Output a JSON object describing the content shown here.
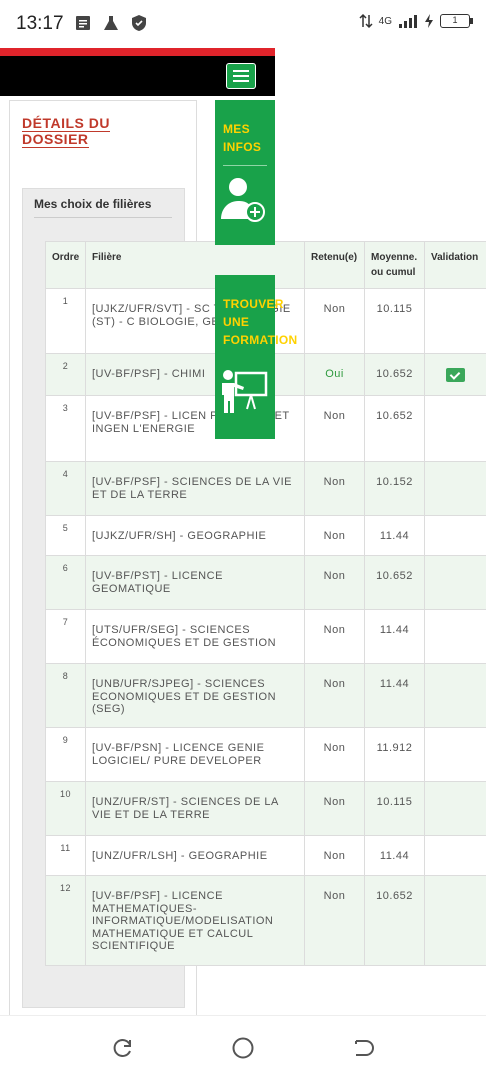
{
  "status_bar": {
    "time": "13:17",
    "network": "4G",
    "battery": "1"
  },
  "header": {
    "menu_icon": "hamburger-icon"
  },
  "panel": {
    "title": "DÉTAILS DU DOSSIER",
    "choices_title": "Mes choix de filières"
  },
  "cards": {
    "my_info_label": "MES\nINFOS",
    "my_info_icon": "user-add-icon",
    "find_training_label": "TROUVER\nUNE\nFORMATION",
    "find_training_icon": "teacher-board-icon"
  },
  "table": {
    "headers": [
      "Ordre",
      "Filière",
      "Retenu(e)",
      "Moyenne. ou cumul",
      "Validation"
    ],
    "rows": [
      {
        "ordre": "1",
        "filiere": "[UJKZ/UFR/SVT] - SC TEHNOLOGIE (ST) - C BIOLOGIE, GEOLOGI",
        "retenu": "Non",
        "moyenne": "10.115",
        "validated": false
      },
      {
        "ordre": "2",
        "filiere": "[UV-BF/PSF] - CHIMI",
        "retenu": "Oui",
        "moyenne": "10.652",
        "validated": true
      },
      {
        "ordre": "3",
        "filiere": "[UV-BF/PSF] - LICEN PHYSIQUE ET INGEN L'ENERGIE",
        "retenu": "Non",
        "moyenne": "10.652",
        "validated": false
      },
      {
        "ordre": "4",
        "filiere": "[UV-BF/PSF] - SCIENCES DE LA VIE ET DE LA TERRE",
        "retenu": "Non",
        "moyenne": "10.152",
        "validated": false
      },
      {
        "ordre": "5",
        "filiere": "[UJKZ/UFR/SH] - GEOGRAPHIE",
        "retenu": "Non",
        "moyenne": "11.44",
        "validated": false
      },
      {
        "ordre": "6",
        "filiere": "[UV-BF/PST] - LICENCE GEOMATIQUE",
        "retenu": "Non",
        "moyenne": "10.652",
        "validated": false
      },
      {
        "ordre": "7",
        "filiere": "[UTS/UFR/SEG] - SCIENCES ÉCONOMIQUES ET DE GESTION",
        "retenu": "Non",
        "moyenne": "11.44",
        "validated": false
      },
      {
        "ordre": "8",
        "filiere": "[UNB/UFR/SJPEG] - SCIENCES ECONOMIQUES ET DE GESTION (SEG)",
        "retenu": "Non",
        "moyenne": "11.44",
        "validated": false
      },
      {
        "ordre": "9",
        "filiere": "[UV-BF/PSN] - LICENCE GENIE LOGICIEL/ PURE DEVELOPER",
        "retenu": "Non",
        "moyenne": "11.912",
        "validated": false
      },
      {
        "ordre": "10",
        "filiere": "[UNZ/UFR/ST] - SCIENCES DE LA VIE ET DE LA TERRE",
        "retenu": "Non",
        "moyenne": "10.115",
        "validated": false
      },
      {
        "ordre": "11",
        "filiere": "[UNZ/UFR/LSH] - GEOGRAPHIE",
        "retenu": "Non",
        "moyenne": "11.44",
        "validated": false
      },
      {
        "ordre": "12",
        "filiere": "[UV-BF/PSF] - LICENCE MATHEMATIQUES-INFORMATIQUE/MODELISATION MATHEMATIQUE ET CALCUL SCIENTIFIQUE",
        "retenu": "Non",
        "moyenne": "10.652",
        "validated": false
      }
    ]
  },
  "colors": {
    "accent_green": "#19a24a",
    "label_yellow": "#ffd200",
    "title_red": "#c0392b",
    "header_red": "#e0242b"
  },
  "navbar": {
    "icons": [
      "recent-apps-icon",
      "home-icon",
      "back-icon"
    ]
  }
}
